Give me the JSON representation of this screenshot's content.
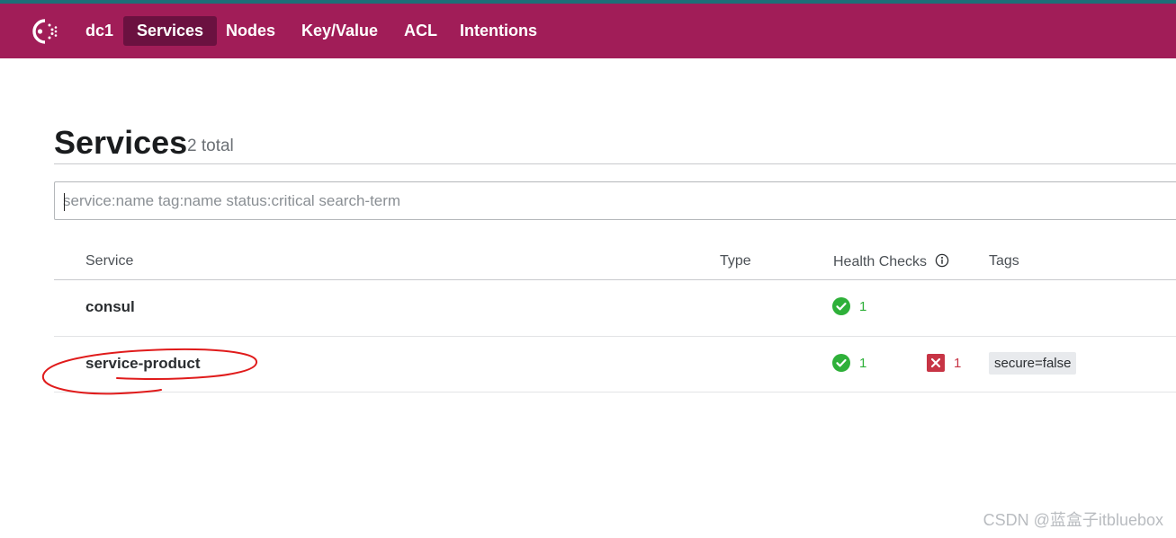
{
  "nav": {
    "datacenter": "dc1",
    "items": [
      {
        "label": "Services",
        "active": true
      },
      {
        "label": "Nodes"
      },
      {
        "label": "Key/Value"
      },
      {
        "label": "ACL"
      },
      {
        "label": "Intentions"
      }
    ]
  },
  "page": {
    "title": "Services",
    "count": "2 total"
  },
  "search": {
    "placeholder": "service:name tag:name status:critical search-term",
    "value": ""
  },
  "table": {
    "headers": {
      "service": "Service",
      "type": "Type",
      "health": "Health Checks",
      "tags": "Tags"
    },
    "rows": [
      {
        "name": "consul",
        "passing": "1",
        "critical": "",
        "tag": ""
      },
      {
        "name": "service-product",
        "passing": "1",
        "critical": "1",
        "tag": "secure=false"
      }
    ]
  },
  "watermark": "CSDN @蓝盒子itbluebox",
  "colors": {
    "navbar": "#a11d58",
    "active_nav": "#6b1140",
    "passing": "#2eb039",
    "critical": "#c73445",
    "annotation": "#e01b1b"
  },
  "icons": [
    "consul-logo-icon",
    "passing-check-icon",
    "critical-x-icon",
    "info-icon"
  ]
}
